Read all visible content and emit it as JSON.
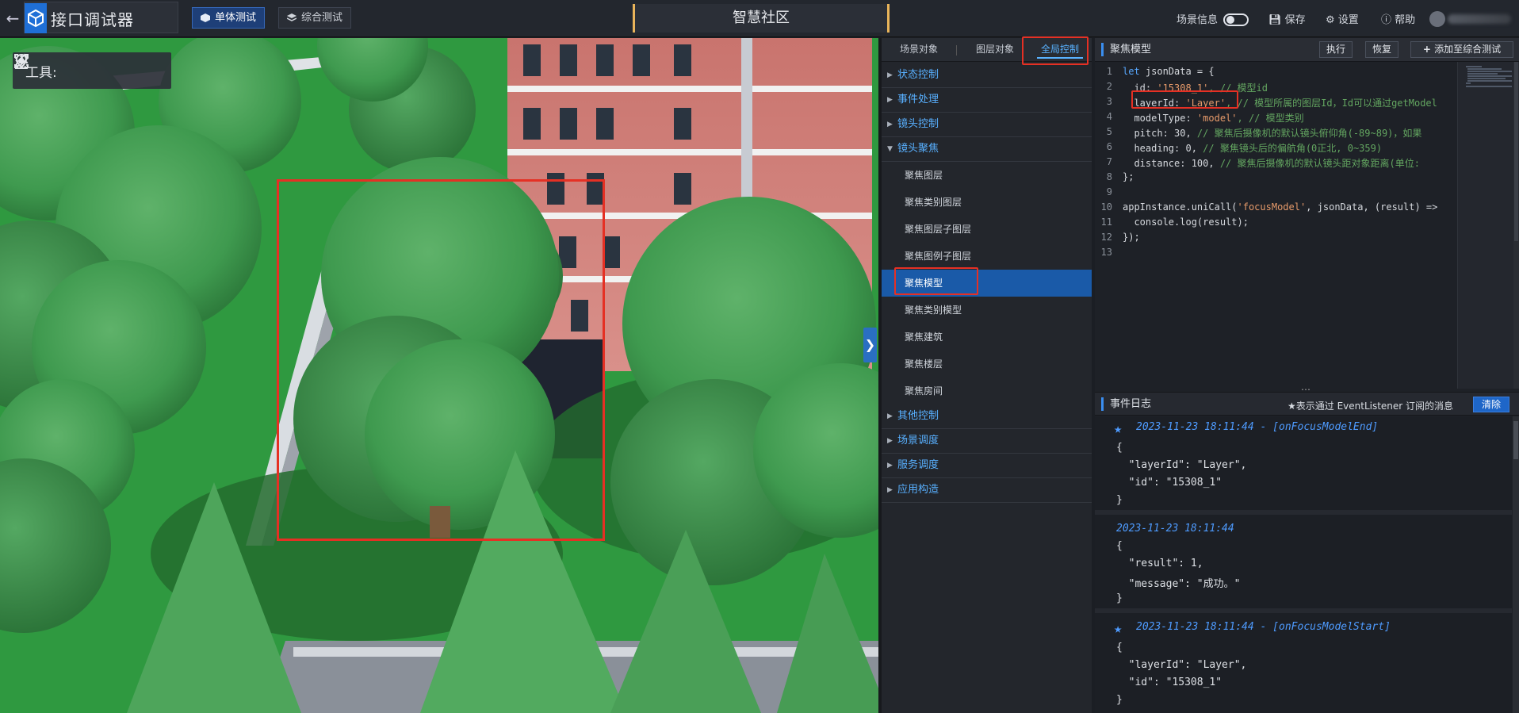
{
  "app": {
    "title": "接口调试器",
    "back_icon": "back-arrow-icon",
    "logo_icon": "cube-logo-icon"
  },
  "modes": [
    {
      "label": "单体测试",
      "active": true,
      "icon": "cube-icon"
    },
    {
      "label": "综合测试",
      "active": false,
      "icon": "layers-icon"
    }
  ],
  "scene_title": "智慧社区",
  "top_right": {
    "scene_info": "场景信息",
    "scene_info_on": false,
    "save": "保存",
    "settings": "设置",
    "help": "帮助"
  },
  "viewport": {
    "toolbox_label": "工具:",
    "tools": [
      "location-pin-icon",
      "focus-frame-icon",
      "pen-icon",
      "gears-icon"
    ],
    "expand_icon": "chevron-right-icon"
  },
  "panel": {
    "tabs": [
      {
        "label": "场景对象",
        "active": false
      },
      {
        "label": "图层对象",
        "active": false
      },
      {
        "label": "全局控制",
        "active": true
      }
    ],
    "categories": [
      {
        "label": "状态控制",
        "expanded": false,
        "items": []
      },
      {
        "label": "事件处理",
        "expanded": false,
        "items": []
      },
      {
        "label": "镜头控制",
        "expanded": false,
        "items": []
      },
      {
        "label": "镜头聚焦",
        "expanded": true,
        "items": [
          "聚焦图层",
          "聚焦类别图层",
          "聚焦图层子图层",
          "聚焦图例子图层",
          "聚焦模型",
          "聚焦类别模型",
          "聚焦建筑",
          "聚焦楼层",
          "聚焦房间"
        ],
        "active_item": "聚焦模型"
      },
      {
        "label": "其他控制",
        "expanded": false,
        "items": []
      },
      {
        "label": "场景调度",
        "expanded": false,
        "items": []
      },
      {
        "label": "服务调度",
        "expanded": false,
        "items": []
      },
      {
        "label": "应用构造",
        "expanded": false,
        "items": []
      }
    ]
  },
  "editor": {
    "title": "聚焦模型",
    "run": "执行",
    "reset": "恢复",
    "add": "添加至综合测试",
    "line_numbers": [
      "1",
      "2",
      "3",
      "4",
      "5",
      "6",
      "7",
      "8",
      "9",
      "10",
      "11",
      "12",
      "13"
    ],
    "code": {
      "l1_kw": "let",
      "l1_rest": " jsonData = {",
      "l2_key": "  id: ",
      "l2_val": "'15308_1'",
      "l2_cm": ", // 模型id",
      "l3_key": "  layerId: ",
      "l3_val": "'Layer'",
      "l3_cm": ", // 模型所属的图层Id，Id可以通过getModel",
      "l4_key": "  modelType: ",
      "l4_val": "'model'",
      "l4_cm": ", // 模型类别",
      "l5_key": "  pitch: 30, ",
      "l5_cm": "// 聚焦后摄像机的默认镜头俯仰角(-89~89)，如果",
      "l6_key": "  heading: 0, ",
      "l6_cm": "// 聚焦镜头后的偏航角(0正北, 0~359)",
      "l7_key": "  distance: 100, ",
      "l7_cm": "// 聚焦后摄像机的默认镜头距对象距离(单位:",
      "l8": "};",
      "l10_a": "appInstance.uniCall(",
      "l10_str": "'focusModel'",
      "l10_b": ", jsonData, (result) =>",
      "l11": "  console.log(result);",
      "l12": "});"
    }
  },
  "log": {
    "title": "事件日志",
    "hint": "★表示通过 EventListener 订阅的消息",
    "clear": "清除",
    "entries": [
      {
        "starred": true,
        "header": "2023-11-23 18:11:44 - [onFocusModelEnd]",
        "lines": [
          "{",
          "  \"layerId\": \"Layer\",",
          "  \"id\": \"15308_1\"",
          "}"
        ]
      },
      {
        "starred": false,
        "header": "2023-11-23 18:11:44",
        "lines": [
          "{",
          "  \"result\": 1,",
          "  \"message\": \"成功。\"",
          "}"
        ]
      },
      {
        "starred": true,
        "header": "2023-11-23 18:11:44 - [onFocusModelStart]",
        "lines": [
          "{",
          "  \"layerId\": \"Layer\",",
          "  \"id\": \"15308_1\"",
          "}"
        ]
      }
    ]
  },
  "colors": {
    "accent": "#1e66c8",
    "link_blue": "#58b0ff",
    "highlight_red": "#e53024",
    "active_menu": "#1a5aa8"
  }
}
